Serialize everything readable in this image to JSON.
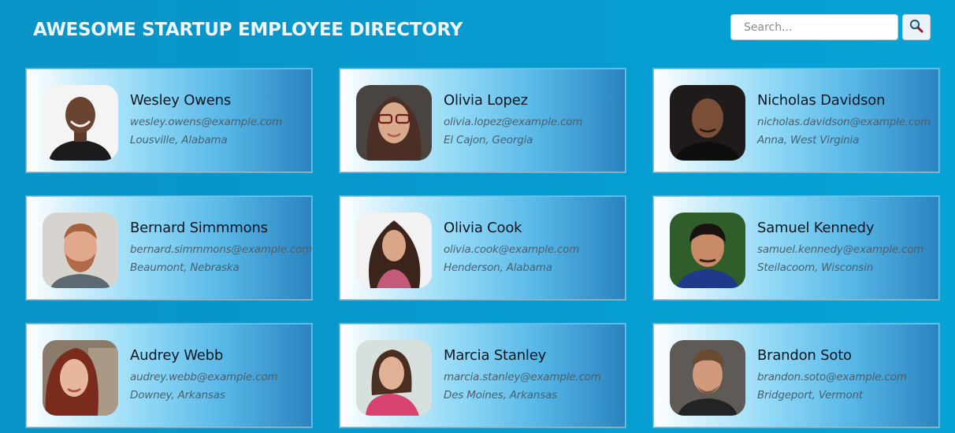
{
  "header": {
    "title": "Awesome Startup Employee Directory",
    "search_placeholder": "Search...",
    "search_icon": "magnifier-icon"
  },
  "colors": {
    "background": "#069bd0",
    "title_text": "#eef6fb",
    "card_gradient_start": "#ffffff",
    "card_gradient_end": "#2a83bf"
  },
  "employees": [
    {
      "name": "Wesley Owens",
      "email": "wesley.owens@example.com",
      "location": "Lousville, Alabama"
    },
    {
      "name": "Olivia Lopez",
      "email": "olivia.lopez@example.com",
      "location": "El Cajon, Georgia"
    },
    {
      "name": "Nicholas Davidson",
      "email": "nicholas.davidson@example.com",
      "location": "Anna, West Virginia"
    },
    {
      "name": "Bernard Simmmons",
      "email": "bernard.simmmons@example.com",
      "location": "Beaumont, Nebraska"
    },
    {
      "name": "Olivia Cook",
      "email": "olivia.cook@example.com",
      "location": "Henderson, Alabama"
    },
    {
      "name": "Samuel Kennedy",
      "email": "samuel.kennedy@example.com",
      "location": "Steilacoom, Wisconsin"
    },
    {
      "name": "Audrey Webb",
      "email": "audrey.webb@example.com",
      "location": "Downey, Arkansas"
    },
    {
      "name": "Marcia Stanley",
      "email": "marcia.stanley@example.com",
      "location": "Des Moines, Arkansas"
    },
    {
      "name": "Brandon Soto",
      "email": "brandon.soto@example.com",
      "location": "Bridgeport, Vermont"
    }
  ]
}
